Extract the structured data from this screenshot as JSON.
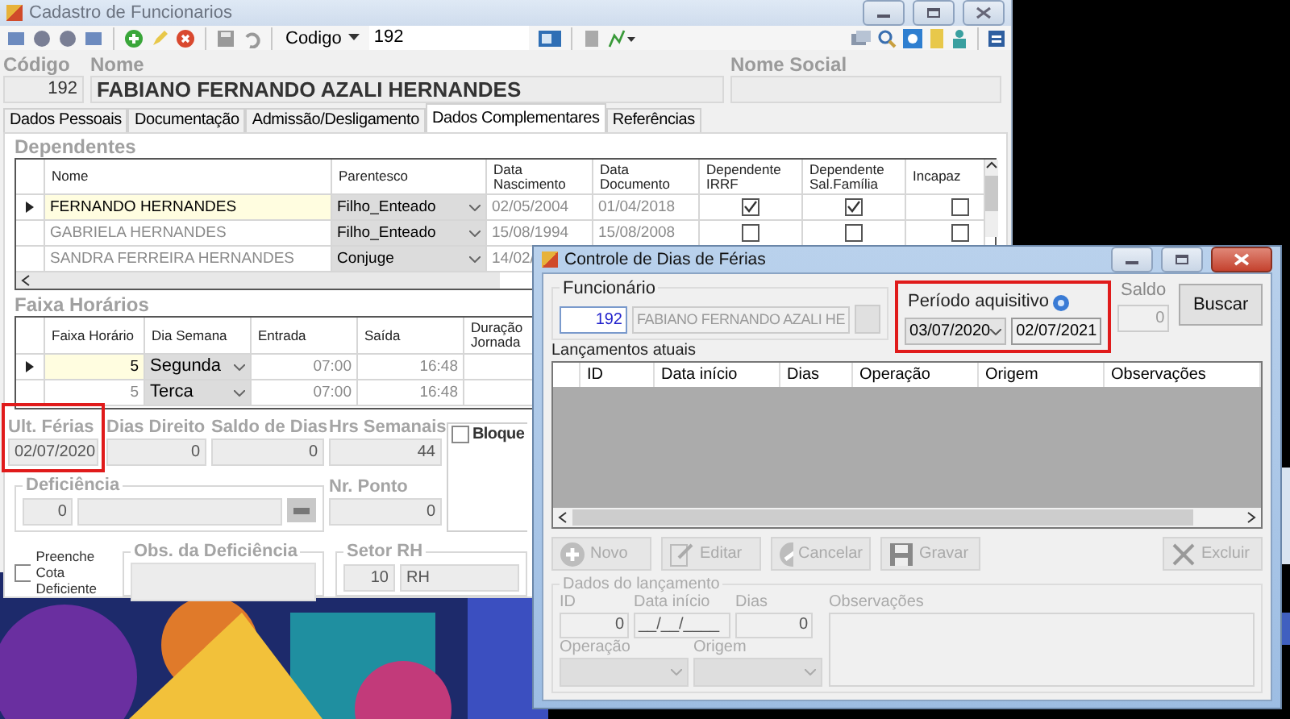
{
  "main_window": {
    "title": "Cadastro de Funcionarios",
    "toolbar": {
      "dropdown": "Codigo",
      "value": "192"
    },
    "header": {
      "code_label": "Código",
      "code": "192",
      "name_label": "Nome",
      "name": "FABIANO FERNANDO AZALI HERNANDES",
      "social_name_label": "Nome Social"
    },
    "tabs": [
      {
        "label": "Dados Pessoais",
        "selected": false
      },
      {
        "label": "Documentação",
        "selected": false
      },
      {
        "label": "Admissão/Desligamento",
        "selected": false
      },
      {
        "label": "Dados Complementares",
        "selected": true
      },
      {
        "label": "Referências",
        "selected": false
      }
    ],
    "dependents": {
      "title": "Dependentes",
      "columns": [
        "Nome",
        "Parentesco",
        "Data Nascimento",
        "Data Documento",
        "Dependente IRRF",
        "Dependente Sal.Família",
        "Incapaz"
      ],
      "rows": [
        {
          "current": true,
          "name": "FERNANDO HERNANDES",
          "relation": "Filho_Enteado",
          "birth": "02/05/2004",
          "document": "01/04/2018",
          "irrf": true,
          "family": true,
          "incapable": false
        },
        {
          "current": false,
          "name": "GABRIELA HERNANDES",
          "relation": "Filho_Enteado",
          "birth": "15/08/1994",
          "document": "15/08/2008",
          "irrf": false,
          "family": false,
          "incapable": false
        },
        {
          "current": false,
          "name": "SANDRA FERREIRA HERNANDES",
          "relation": "Conjuge",
          "birth": "14/02/"
        }
      ]
    },
    "schedule": {
      "title": "Faixa Horários",
      "columns": [
        "Faixa Horário",
        "Dia Semana",
        "Entrada",
        "Saída",
        "Duração Jornada"
      ],
      "rows": [
        {
          "current": true,
          "band": "5",
          "day": "Segunda",
          "start": "07:00",
          "end": "16:48"
        },
        {
          "current": false,
          "band": "5",
          "day": "Terca",
          "start": "07:00",
          "end": "16:48"
        }
      ]
    },
    "last_vacation": {
      "label": "Ult. Férias",
      "value": "02/07/2020"
    },
    "days_right": {
      "label": "Dias Direito",
      "value": "0"
    },
    "days_balance": {
      "label": "Saldo de Dias",
      "value": "0"
    },
    "weekly_hours": {
      "label": "Hrs Semanais",
      "value": "44"
    },
    "block": {
      "label": "Bloque",
      "checked": false
    },
    "disability": {
      "label": "Deficiência",
      "code": "0"
    },
    "punch_number": {
      "label": "Nr. Ponto",
      "value": "0"
    },
    "quota": {
      "label": "Preenche Cota Deficiente",
      "checked": false
    },
    "disability_notes": {
      "label": "Obs. da Deficiência"
    },
    "hr_sector": {
      "label": "Setor RH",
      "code": "10",
      "name": "RH"
    }
  },
  "vacation_window": {
    "title": "Controle de Dias de Férias",
    "employee": {
      "label": "Funcionário",
      "code": "192",
      "name": "FABIANO FERNANDO AZALI HE"
    },
    "period": {
      "label": "Período aquisitivo",
      "start": "03/07/2020",
      "end": "02/07/2021"
    },
    "balance": {
      "label": "Saldo",
      "value": "0"
    },
    "search_button": "Buscar",
    "entries": {
      "title": "Lançamentos atuais",
      "columns": [
        "ID",
        "Data início",
        "Dias",
        "Operação",
        "Origem",
        "Observações"
      ]
    },
    "actions": [
      {
        "label": "Novo",
        "kind": "add",
        "disabled": true
      },
      {
        "label": "Editar",
        "kind": "edit",
        "disabled": true
      },
      {
        "label": "Cancelar",
        "kind": "cancel",
        "disabled": true
      },
      {
        "label": "Gravar",
        "kind": "save",
        "disabled": true
      },
      {
        "label": "Excluir",
        "kind": "delete",
        "disabled": true
      }
    ],
    "entry": {
      "title": "Dados do lançamento",
      "id_label": "ID",
      "id": "0",
      "start_label": "Data início",
      "start": "__/__/____",
      "days_label": "Dias",
      "days": "0",
      "notes_label": "Observações",
      "operation_label": "Operação",
      "origin_label": "Origem"
    }
  }
}
